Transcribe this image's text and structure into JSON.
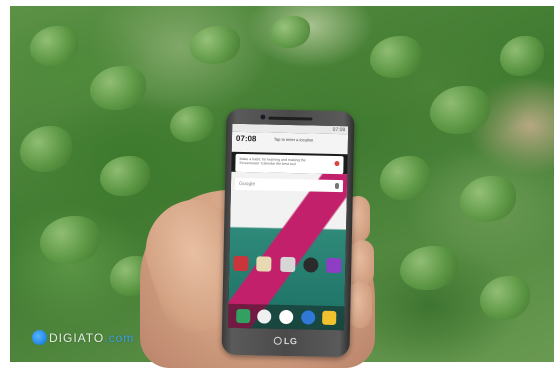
{
  "phone": {
    "status_time": "07:08",
    "clock": "07:08",
    "date": "",
    "location_hint": "Tap to enter a location",
    "tip_text": "Make a habit: for learning and making the Screensaver Calendar the best tool",
    "search_word": "Google",
    "brand_logo": "LG",
    "apps_row1": [
      {
        "icon": "calendar-icon",
        "color": "#c9353b",
        "label": ""
      },
      {
        "icon": "gallery-icon",
        "color": "#e7d9b2",
        "label": ""
      },
      {
        "icon": "music-icon",
        "color": "#d6d6d6",
        "label": ""
      },
      {
        "icon": "camera-icon",
        "color": "#2b2b2b",
        "label": ""
      },
      {
        "icon": "store-icon",
        "color": "#8e3ec4",
        "label": ""
      }
    ],
    "dock": [
      {
        "icon": "phone-icon",
        "color": "#32a060"
      },
      {
        "icon": "contacts-icon",
        "color": "#f0f0f0"
      },
      {
        "icon": "apps-icon",
        "color": "#ffffff"
      },
      {
        "icon": "browser-icon",
        "color": "#2f78d8"
      },
      {
        "icon": "messages-icon",
        "color": "#f2c12e"
      }
    ]
  },
  "watermark": {
    "brand": "DIGIATO",
    "suffix": ".com"
  },
  "colors": {
    "leaf_green": "#5e9a45",
    "wallpaper_magenta": "#c2206b",
    "wallpaper_teal": "#1c7063",
    "watermark_blue": "#1e86e4"
  }
}
